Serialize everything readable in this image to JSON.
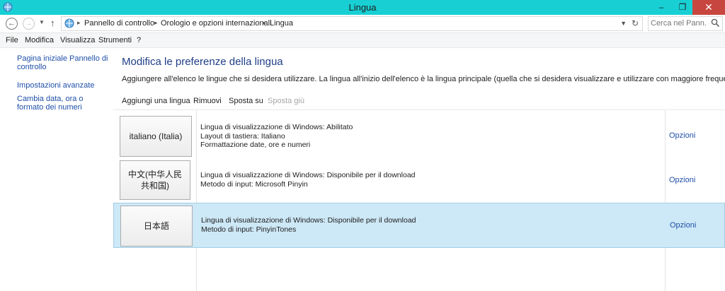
{
  "window": {
    "title": "Lingua",
    "minimize": "–",
    "restore": "❐",
    "close": "✕"
  },
  "address": {
    "crumbs": [
      "Pannello di controllo",
      "Orologio e opzioni internazionali",
      "Lingua"
    ],
    "search_placeholder": "Cerca nel Pann..."
  },
  "menu": [
    "File",
    "Modifica",
    "Visualizza",
    "Strumenti",
    "?"
  ],
  "sidebar": {
    "links": [
      "Pagina iniziale Pannello di controllo",
      "Impostazioni avanzate",
      "Cambia data, ora o formato dei numeri"
    ]
  },
  "main": {
    "title": "Modifica le preferenze della lingua",
    "description": "Aggiungere all'elenco le lingue che si desidera utilizzare. La lingua all'inizio dell'elenco è la lingua principale (quella che si desidera visualizzare e utilizzare con maggiore frequenza).",
    "toolbar": {
      "add": "Aggiungi una lingua",
      "remove": "Rimuovi",
      "move_up": "Sposta su",
      "move_down": "Sposta giù"
    },
    "languages": [
      {
        "name": "italiano (Italia)",
        "details": [
          "Lingua di visualizzazione di Windows: Abilitato",
          "Layout di tastiera: Italiano",
          "Formattazione date, ore e numeri"
        ],
        "options": "Opzioni",
        "selected": false
      },
      {
        "name": "中文(中华人民共和国)",
        "details": [
          "Lingua di visualizzazione di Windows: Disponibile per il download",
          "Metodo di input: Microsoft Pinyin"
        ],
        "options": "Opzioni",
        "selected": false
      },
      {
        "name": "日本語",
        "details": [
          "Lingua di visualizzazione di Windows: Disponibile per il download",
          "Metodo di input: PinyinTones"
        ],
        "options": "Opzioni",
        "selected": true
      }
    ]
  },
  "colors": {
    "titlebar": "#18d0d4",
    "link": "#1f4fa8",
    "heading": "#1e3d87",
    "selection": "#cde8f6",
    "close_button": "#c7463f"
  }
}
